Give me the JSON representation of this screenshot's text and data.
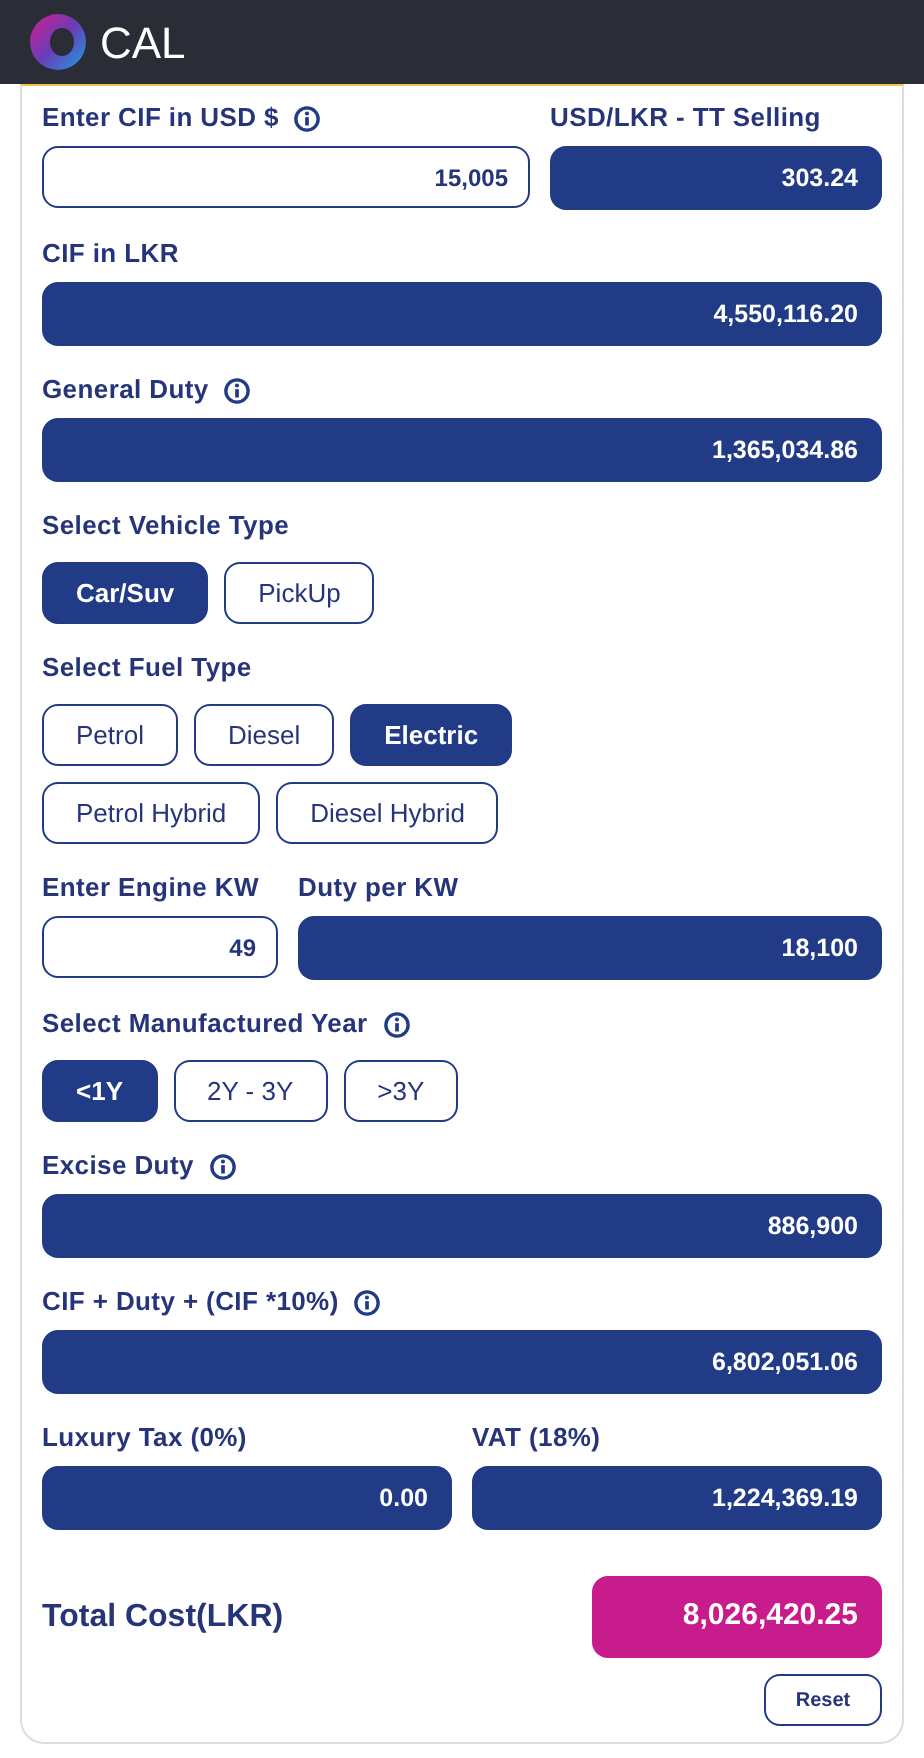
{
  "header": {
    "logo_text": "CAL"
  },
  "sections": [
    {
      "kind": "fields",
      "fields": [
        {
          "label": "Enter CIF in USD $",
          "info": true,
          "kind": "input",
          "value": "15,005"
        },
        {
          "label": "USD/LKR - TT Selling",
          "info": false,
          "kind": "output",
          "value": "303.24"
        }
      ]
    },
    {
      "kind": "fields",
      "fields": [
        {
          "label": "CIF in LKR",
          "info": false,
          "kind": "output",
          "value": "4,550,116.20"
        }
      ]
    },
    {
      "kind": "fields",
      "fields": [
        {
          "label": "General Duty",
          "info": true,
          "kind": "output",
          "value": "1,365,034.86"
        }
      ]
    },
    {
      "kind": "choice",
      "label": "Select Vehicle Type",
      "info": false,
      "options": [
        {
          "label": "Car/Suv",
          "selected": true
        },
        {
          "label": "PickUp",
          "selected": false
        }
      ]
    },
    {
      "kind": "choice",
      "label": "Select Fuel Type",
      "info": false,
      "options": [
        {
          "label": "Petrol",
          "selected": false
        },
        {
          "label": "Diesel",
          "selected": false
        },
        {
          "label": "Electric",
          "selected": true
        },
        {
          "label": "Petrol Hybrid",
          "selected": false
        },
        {
          "label": "Diesel Hybrid",
          "selected": false
        }
      ]
    },
    {
      "kind": "fields",
      "fields": [
        {
          "label": "Enter Engine KW",
          "info": false,
          "kind": "input",
          "value": "49"
        },
        {
          "label": "Duty per KW",
          "info": false,
          "kind": "output",
          "value": "18,100"
        }
      ]
    },
    {
      "kind": "choice",
      "label": "Select Manufactured Year",
      "info": true,
      "options": [
        {
          "label": "<1Y",
          "selected": true
        },
        {
          "label": "2Y - 3Y",
          "selected": false
        },
        {
          "label": ">3Y",
          "selected": false
        }
      ]
    },
    {
      "kind": "fields",
      "fields": [
        {
          "label": "Excise Duty",
          "info": true,
          "kind": "output",
          "value": "886,900"
        }
      ]
    },
    {
      "kind": "fields",
      "fields": [
        {
          "label": "CIF + Duty + (CIF *10%)",
          "info": true,
          "kind": "output",
          "value": "6,802,051.06"
        }
      ]
    },
    {
      "kind": "fields",
      "fields": [
        {
          "label": "Luxury Tax (0%)",
          "info": false,
          "kind": "output",
          "value": "0.00"
        },
        {
          "label": "VAT (18%)",
          "info": false,
          "kind": "output",
          "value": "1,224,369.19"
        }
      ]
    }
  ],
  "total": {
    "label": "Total Cost(LKR)",
    "value": "8,026,420.25"
  },
  "reset_button": "Reset"
}
